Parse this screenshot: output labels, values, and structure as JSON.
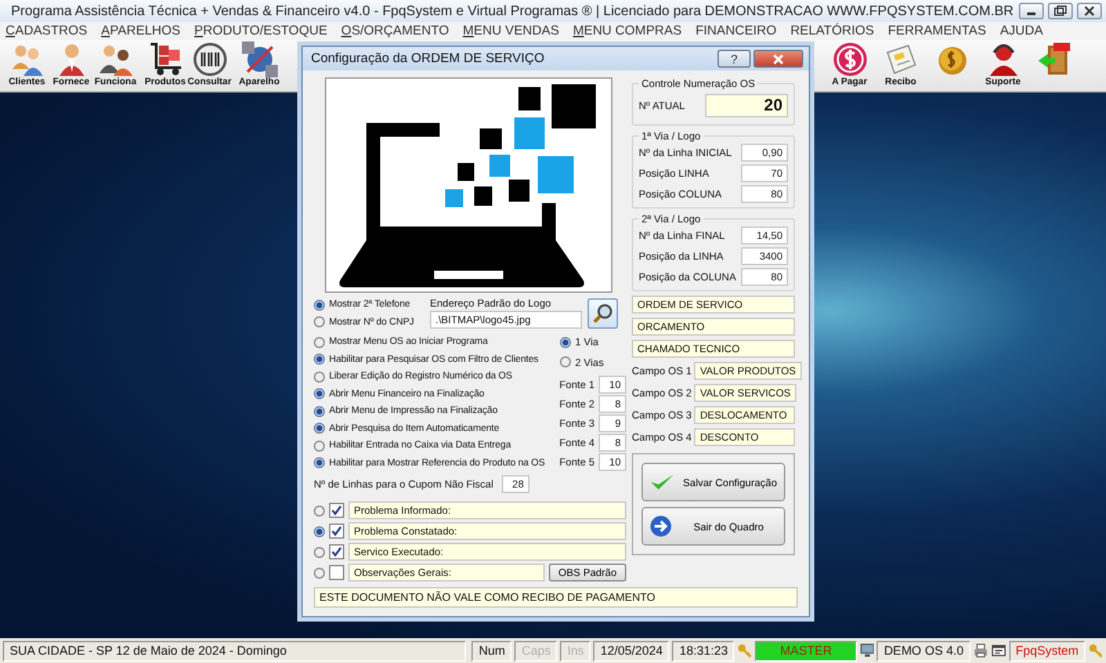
{
  "window": {
    "title": "Programa Assistência Técnica + Vendas & Financeiro v4.0 - FpqSystem e Virtual Programas ® | Licenciado para  DEMONSTRACAO WWW.FPQSYSTEM.COM.BR"
  },
  "menu": [
    {
      "label": "CADASTROS",
      "accelerator": true
    },
    {
      "label": "APARELHOS",
      "accelerator": true
    },
    {
      "label": "PRODUTO/ESTOQUE",
      "accelerator": true
    },
    {
      "label": "OS/ORÇAMENTO",
      "accelerator": true
    },
    {
      "label": "MENU VENDAS",
      "accelerator": true
    },
    {
      "label": "MENU COMPRAS",
      "accelerator": true
    },
    {
      "label": "FINANCEIRO",
      "accelerator": false
    },
    {
      "label": "RELATÓRIOS",
      "accelerator": false
    },
    {
      "label": "FERRAMENTAS",
      "accelerator": false
    },
    {
      "label": "AJUDA",
      "accelerator": false
    }
  ],
  "toolbar_left": [
    {
      "kind": "people",
      "label": "Clientes"
    },
    {
      "kind": "person",
      "label": "Fornece"
    },
    {
      "kind": "couple",
      "label": "Funciona"
    },
    {
      "kind": "cart",
      "label": "Produtos"
    },
    {
      "kind": "barcode",
      "label": "Consultar"
    },
    {
      "kind": "satellite",
      "label": "Aparelho"
    }
  ],
  "toolbar_right": [
    {
      "kind": "dollar",
      "label": "A Pagar"
    },
    {
      "kind": "receipt",
      "label": "Recibo"
    },
    {
      "kind": "coins"
    },
    {
      "kind": "support",
      "label": "Suporte"
    },
    {
      "kind": "exit"
    }
  ],
  "dialog": {
    "title": "Configuração da ORDEM DE SERVIÇO",
    "help": "?",
    "os_control": {
      "title": "Controle Numeração OS",
      "label": "Nº ATUAL",
      "value": "20"
    },
    "via1": {
      "title": "1ª Via / Logo",
      "fields": [
        {
          "label": "Nº da Linha INICIAL",
          "value": "0,90"
        },
        {
          "label": "Posição LINHA",
          "value": "70"
        },
        {
          "label": "Posição COLUNA",
          "value": "80"
        }
      ]
    },
    "via2": {
      "title": "2ª Via / Logo",
      "fields": [
        {
          "label": "Nº da Linha FINAL",
          "value": "14,50"
        },
        {
          "label": "Posição da LINHA",
          "value": "3400"
        },
        {
          "label": "Posição da COLUNA",
          "value": "80"
        }
      ]
    },
    "logo_path": {
      "label": "Endereço Padrão do Logo",
      "value": ".\\BITMAP\\logo45.jpg"
    },
    "options": [
      {
        "label": "Mostrar 2ª Telefone",
        "checked": true
      },
      {
        "label": "Mostrar Nº do CNPJ",
        "checked": false
      },
      {
        "label": "Mostrar Menu OS ao Iniciar Programa",
        "checked": false
      },
      {
        "label": "Habilitar para Pesquisar OS com Filtro de Clientes",
        "checked": true
      },
      {
        "label": "Liberar Edição do Registro Numérico da OS",
        "checked": false
      },
      {
        "label": "Abrir Menu Financeiro na Finalização",
        "checked": true
      },
      {
        "label": "Abrir Menu de Impressão na Finalização",
        "checked": true
      },
      {
        "label": "Abrir Pesquisa do Item Automaticamente",
        "checked": true
      },
      {
        "label": "Habilitar Entrada no Caixa via Data Entrega",
        "checked": false
      },
      {
        "label": "Habilitar para Mostrar Referencia do Produto na OS",
        "checked": true
      }
    ],
    "vias": [
      {
        "label": "1 Via",
        "selected": true
      },
      {
        "label": "2 Vias",
        "selected": false
      }
    ],
    "fonts": [
      {
        "label": "Fonte 1",
        "value": "10"
      },
      {
        "label": "Fonte 2",
        "value": "8"
      },
      {
        "label": "Fonte 3",
        "value": "9"
      },
      {
        "label": "Fonte 4",
        "value": "8"
      },
      {
        "label": "Fonte 5",
        "value": "10"
      }
    ],
    "coupon_lines": {
      "label": "Nº de Linhas para o Cupom Não Fiscal",
      "value": "28"
    },
    "sections": [
      {
        "selected": false,
        "checked": true,
        "value": "Problema Informado:"
      },
      {
        "selected": true,
        "checked": true,
        "value": "Problema Constatado:"
      },
      {
        "selected": false,
        "checked": true,
        "value": "Servico Executado:"
      },
      {
        "selected": false,
        "checked": false,
        "value": "Observações Gerais:"
      }
    ],
    "obs_button": "OBS Padrão",
    "titles": [
      "ORDEM DE SERVICO",
      "ORCAMENTO",
      "CHAMADO TECNICO"
    ],
    "campos": [
      {
        "label": "Campo OS 1",
        "value": "VALOR PRODUTOS"
      },
      {
        "label": "Campo OS 2",
        "value": "VALOR SERVICOS"
      },
      {
        "label": "Campo OS 3",
        "value": "DESLOCAMENTO"
      },
      {
        "label": "Campo OS 4",
        "value": "DESCONTO"
      }
    ],
    "buttons": [
      {
        "kind": "save",
        "label": "Salvar Configuração"
      },
      {
        "kind": "exit",
        "label": "Sair do Quadro"
      }
    ],
    "footer": "ESTE DOCUMENTO NÃO VALE COMO RECIBO DE PAGAMENTO"
  },
  "status_bar": {
    "location": "SUA CIDADE - SP 12 de Maio de 2024 - Domingo",
    "keys": [
      {
        "label": "Num",
        "on": true
      },
      {
        "label": "Caps",
        "on": false
      },
      {
        "label": "Ins",
        "on": false
      }
    ],
    "date": "12/05/2024",
    "time": "18:31:23",
    "user": "MASTER",
    "version": "DEMO OS 4.0",
    "brand": "FpqSystem"
  }
}
